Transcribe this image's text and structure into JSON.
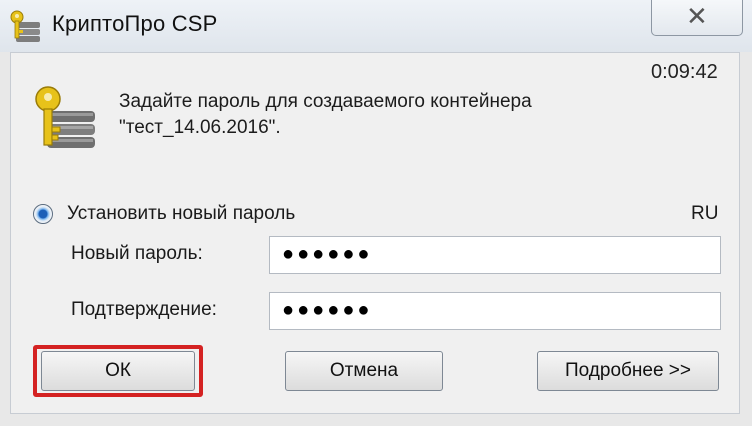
{
  "window": {
    "title": "КриптоПро CSP",
    "close_glyph": "✕"
  },
  "dialog": {
    "timer": "0:09:42",
    "message_line1": "Задайте пароль для создаваемого контейнера",
    "message_line2": "\"тест_14.06.2016\".",
    "radio_label": "Установить новый пароль",
    "radio_selected": true,
    "language": "RU",
    "new_password_label": "Новый пароль:",
    "new_password_value": "●●●●●●",
    "confirm_label": "Подтверждение:",
    "confirm_value": "●●●●●●"
  },
  "buttons": {
    "ok": "ОК",
    "cancel": "Отмена",
    "details": "Подробнее >>"
  },
  "colors": {
    "highlight": "#d42222",
    "key": "#e7c21a"
  },
  "icons": {
    "app": "key-database-icon",
    "message": "key-database-icon",
    "close": "close-icon"
  }
}
